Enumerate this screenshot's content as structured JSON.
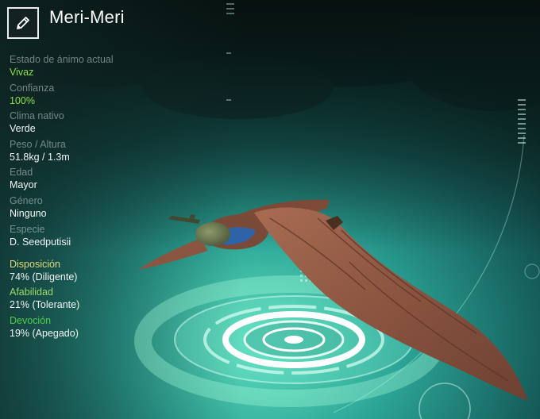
{
  "pal": {
    "name": "Meri-Meri",
    "mood_label": "Estado de ánimo actual",
    "mood_value": "Vivaz",
    "trust_label": "Confianza",
    "trust_value": "100%",
    "climate_label": "Clima nativo",
    "climate_value": "Verde",
    "weight_height_label": "Peso / Altura",
    "weight_height_value": "51.8kg / 1.3m",
    "age_label": "Edad",
    "age_value": "Mayor",
    "gender_label": "Género",
    "gender_value": "Ninguno",
    "species_label": "Especie",
    "species_value": "D. Seedputisii"
  },
  "traits": [
    {
      "label": "Disposición",
      "value": "74% (Diligente)",
      "color": "#e0dc7a"
    },
    {
      "label": "Afabilidad",
      "value": "21% (Tolerante)",
      "color": "#9ed96a"
    },
    {
      "label": "Devoción",
      "value": "19% (Apegado)",
      "color": "#4fcf4a"
    }
  ],
  "icons": {
    "edit": "pencil-icon"
  },
  "colors": {
    "mood": "#8ee04c",
    "trust": "#8ee04c",
    "platform_glow": "#ffffff",
    "creature_body": "#8e5a43",
    "creature_belly": "#2f63a8"
  }
}
